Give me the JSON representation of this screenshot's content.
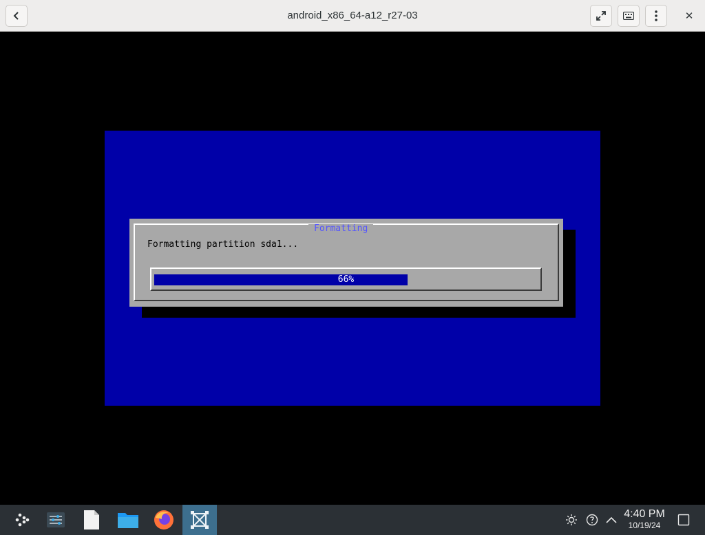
{
  "window": {
    "title": "android_x86_64-a12_r27-03",
    "close_glyph": "✕",
    "buttons": [
      "back-icon",
      "fullscreen-icon",
      "keyboard-icon",
      "kebab-menu-icon"
    ]
  },
  "installer": {
    "dialog_title": "Formatting",
    "message": "Formatting partition sda1...",
    "progress_percent": 66,
    "progress_label": "66%"
  },
  "colors": {
    "vm_background": "#000000",
    "installer_blue": "#0000a8",
    "dialog_gray": "#a8a8a8",
    "dialog_title": "#5454ff",
    "taskbar": "#2b3035",
    "active_task": "#3d6f8e"
  },
  "taskbar": {
    "apps": [
      {
        "icon": "app-launcher-icon"
      },
      {
        "icon": "system-settings-icon"
      },
      {
        "icon": "text-file-icon"
      },
      {
        "icon": "folder-icon"
      },
      {
        "icon": "firefox-icon"
      },
      {
        "icon": "virtual-machine-icon",
        "active": true
      }
    ],
    "tray": [
      "brightness-icon",
      "network-icon",
      "show-hidden-icon",
      "desktop-icon"
    ],
    "clock": {
      "time": "4:40 PM",
      "date": "10/19/24"
    }
  }
}
